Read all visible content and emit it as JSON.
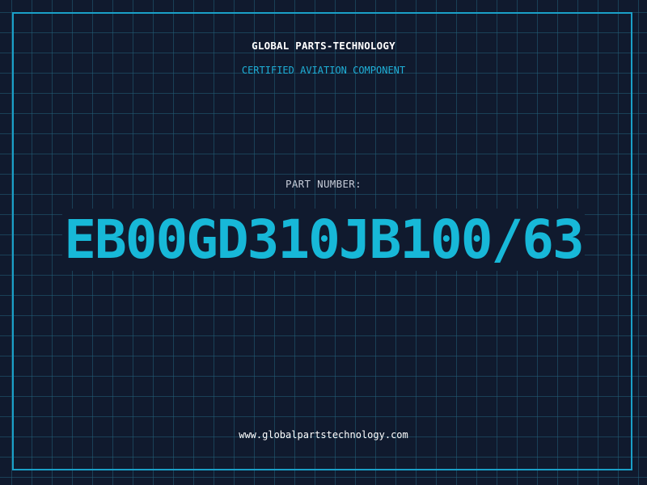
{
  "header": {
    "brand": "GLOBAL PARTS-TECHNOLOGY",
    "tagline": "CERTIFIED AVIATION COMPONENT"
  },
  "main": {
    "part_label": "PART NUMBER:",
    "part_number": "EB00GD310JB100/63"
  },
  "footer": {
    "website": "www.globalpartstechnology.com"
  },
  "colors": {
    "background": "#101a2e",
    "grid": "#235f78",
    "accent": "#17b8d8",
    "frame": "#1aa0c8",
    "text_primary": "#ffffff",
    "text_muted": "#c6ccd8"
  }
}
